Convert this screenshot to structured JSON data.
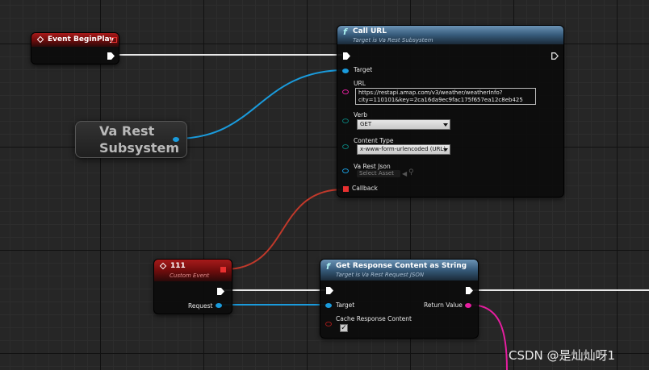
{
  "canvas": {
    "background": "#262626"
  },
  "event_beginplay": {
    "title": "Event BeginPlay"
  },
  "call_url": {
    "title": "Call URL",
    "subtitle": "Target is Va Rest Subsystem",
    "target_label": "Target",
    "url_label": "URL",
    "url_line1": "https://restapi.amap.com/v3/weather/weatherInfo?",
    "url_line2": "city=110101&key=2ca16da9ec9fac175f657ea12c8eb425",
    "verb_label": "Verb",
    "verb_value": "GET",
    "content_type_label": "Content Type",
    "content_type_value": "x-www-form-urlencoded (URL)",
    "varest_json_label": "Va Rest Json",
    "select_asset": "Select Asset",
    "callback_label": "Callback"
  },
  "varest_subsystem": {
    "line1": "Va Rest",
    "line2": "Subsystem"
  },
  "custom_event": {
    "title": "111",
    "subtitle": "Custom Event",
    "request_label": "Request"
  },
  "get_response": {
    "title": "Get Response Content as String",
    "subtitle": "Target is Va Rest Request JSON",
    "target_label": "Target",
    "return_label": "Return Value",
    "cache_label": "Cache Response Content",
    "cache_checked": true
  },
  "watermark": "CSDN @是灿灿呀1",
  "colors": {
    "exec": "#ffffff",
    "object": "#1a9bdc",
    "string": "#e61ea0",
    "delegate": "#c0392b",
    "event_header": "#a71a1a",
    "function_header": "#6b93b5"
  }
}
